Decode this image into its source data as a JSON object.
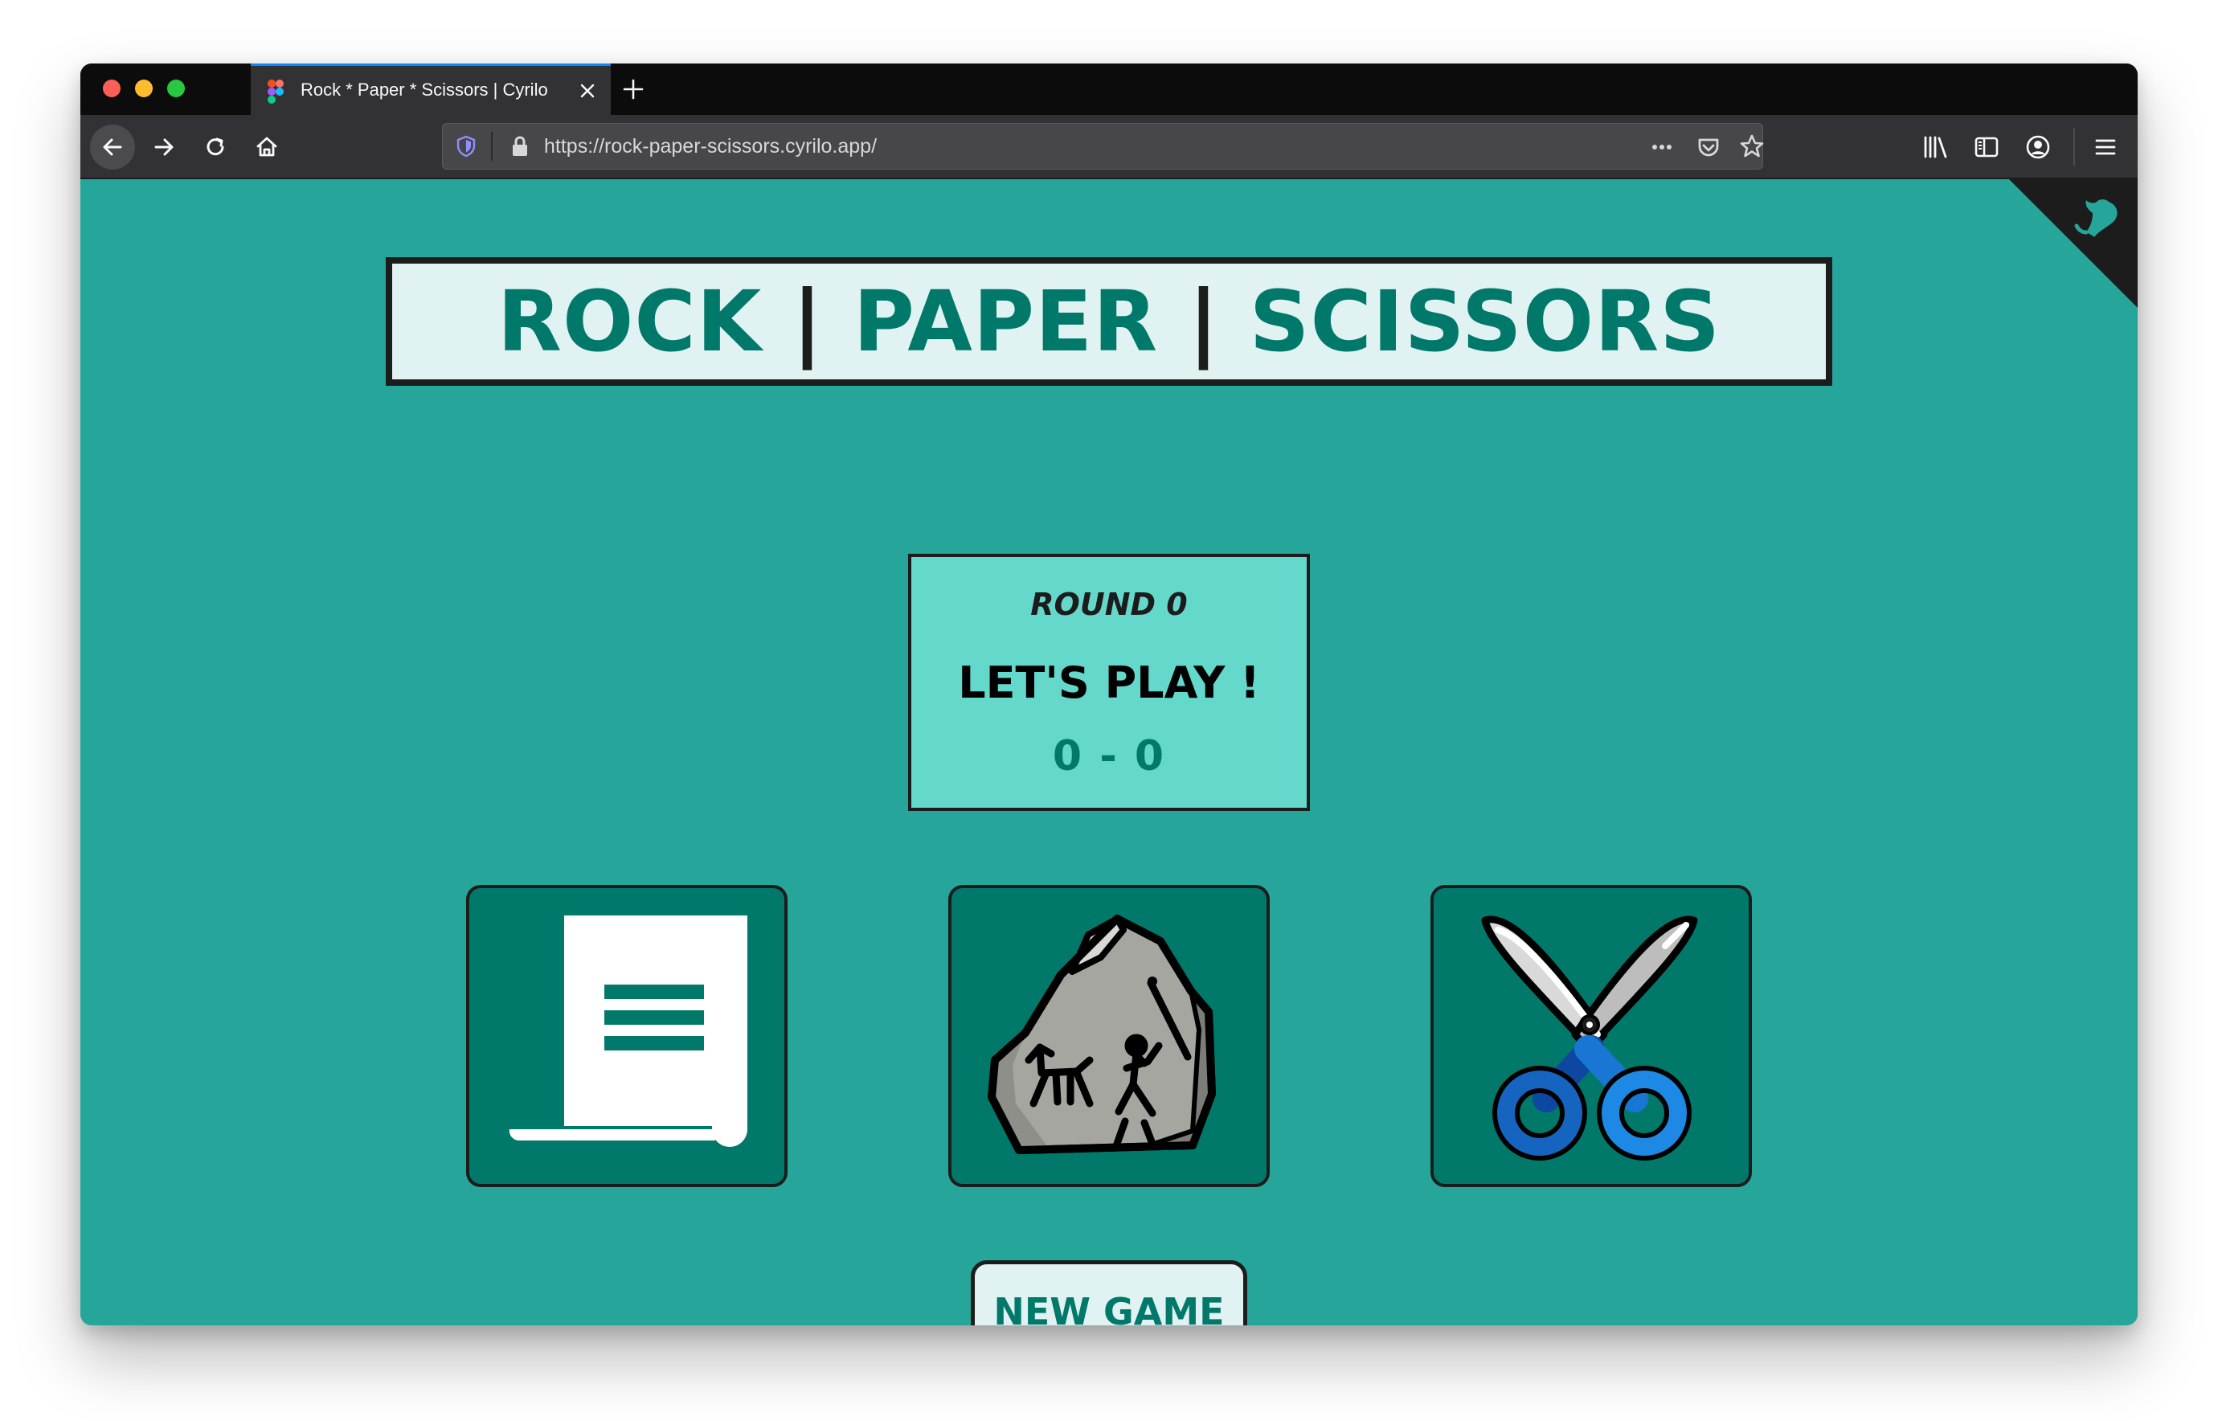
{
  "browser": {
    "tab_title": "Rock * Paper * Scissors | Cyrilo",
    "url": "https://rock-paper-scissors.cyrilo.app/"
  },
  "page": {
    "title_parts": [
      "ROCK",
      "|",
      "PAPER",
      "|",
      "SCISSORS"
    ],
    "round_label": "ROUND 0",
    "status": "LET'S PLAY !",
    "score": "0 - 0",
    "new_game_label": "NEW GAME"
  },
  "choices": [
    {
      "id": "paper",
      "icon": "paper-icon"
    },
    {
      "id": "rock",
      "icon": "rock-icon"
    },
    {
      "id": "scissors",
      "icon": "scissors-icon"
    }
  ],
  "colors": {
    "background": "#26a69a",
    "primary_dark": "#00796b",
    "title_bg": "#e0f2f1",
    "score_bg": "#64d8cb",
    "border": "#1c1c1c",
    "scissors_handle": "#1565c0"
  }
}
